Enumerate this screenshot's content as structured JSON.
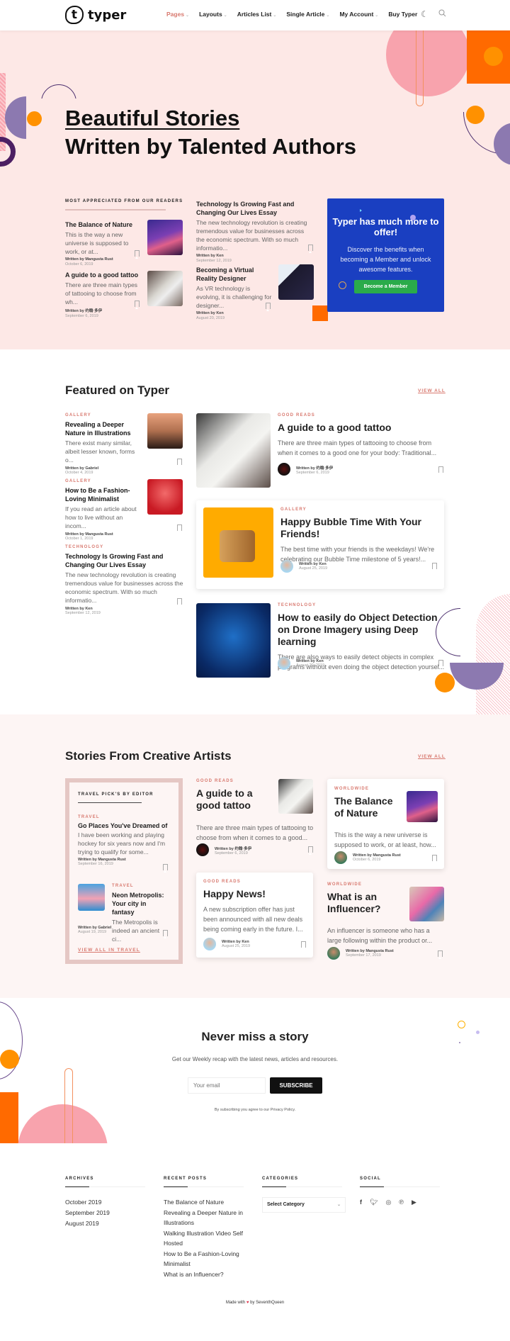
{
  "header": {
    "logo_mark": "t",
    "logo_text": "typer",
    "nav": [
      {
        "label": "Pages",
        "active": true,
        "has_dropdown": true
      },
      {
        "label": "Layouts",
        "active": false,
        "has_dropdown": true
      },
      {
        "label": "Articles List",
        "active": false,
        "has_dropdown": true
      },
      {
        "label": "Single Article",
        "active": false,
        "has_dropdown": true
      },
      {
        "label": "My Account",
        "active": false,
        "has_dropdown": true
      },
      {
        "label": "Buy Typer",
        "active": false,
        "has_dropdown": false
      }
    ],
    "icons": [
      "dark-mode-icon",
      "search-icon"
    ]
  },
  "hero": {
    "title_line1": "Beautiful Stories",
    "title_line2": "Written by Talented Authors",
    "section_label": "MOST APPRECIATED FROM OUR READERS",
    "posts": [
      {
        "title": "The Balance of Nature",
        "excerpt": "This is the way a new universe is supposed to work, or at...",
        "author": "Written by Mangusta Rust",
        "date": "October 6, 2019"
      },
      {
        "title": "A guide to a good tattoo",
        "excerpt": "There are three main types of tattooing to choose from wh...",
        "author": "Written by 约翰·多伊",
        "date": "September 6, 2019"
      },
      {
        "title": "Technology Is Growing Fast and Changing Our Lives Essay",
        "excerpt": "The new technology revolution is creating tremendous value for businesses across the economic spectrum. With so much informatio...",
        "author": "Written by Ken",
        "date": "September 12, 2019"
      },
      {
        "title": "Becoming a Virtual Reality Designer",
        "excerpt": "As VR technology is evolving, it is challenging for designer...",
        "author": "Written by Ken",
        "date": "August 20, 2019"
      }
    ],
    "promo": {
      "title": "Typer has much more to offer!",
      "text": "Discover the benefits when becoming a Member and unlock awesome features.",
      "button": "Become a Member"
    }
  },
  "featured": {
    "title": "Featured on Typer",
    "view_all": "VIEW ALL",
    "side": [
      {
        "category": "GALLERY",
        "title": "Revealing a Deeper Nature in Illustrations",
        "excerpt": "There exist many similar, albeit lesser known, forms o...",
        "author": "Written by Gabriel",
        "date": "October 4, 2019"
      },
      {
        "category": "GALLERY",
        "title": "How to Be a Fashion-Loving Minimalist",
        "excerpt": "If you read an article about how to live without an incom...",
        "author": "Written by Mangusta Rust",
        "date": "October 1, 2019"
      },
      {
        "category": "TECHNOLOGY",
        "title": "Technology Is Growing Fast and Changing Our Lives Essay",
        "excerpt": "The new technology revolution is creating tremendous value for businesses across the economic spectrum. With so much informatio...",
        "author": "Written by Ken",
        "date": "September 12, 2019"
      }
    ],
    "main": [
      {
        "category": "GOOD READS",
        "title": "A guide to a good tattoo",
        "excerpt": "There are three main types of tattooing to choose from when it comes to a good one for your body: Traditional...",
        "author": "Written by 约翰·多伊",
        "date": "September 6, 2019"
      },
      {
        "category": "GALLERY",
        "title": "Happy Bubble Time With Your Friends!",
        "excerpt": "The best time with your friends is the weekdays! We're celebrating our Bubble Time milestone of 5 years!...",
        "author": "Written by Ken",
        "date": "August 25, 2019"
      },
      {
        "category": "TECHNOLOGY",
        "title": "How to easily do Object Detection on Drone Imagery using Deep learning",
        "excerpt": "There are also ways to easily detect objects in complex programs without even doing the object detection yoursel...",
        "author": "Written by Ken",
        "date": "August 20, 2019"
      }
    ]
  },
  "stories": {
    "title": "Stories From Creative Artists",
    "view_all": "VIEW ALL",
    "editor": {
      "label": "TRAVEL PICK'S BY EDITOR",
      "posts": [
        {
          "category": "TRAVEL",
          "title": "Go Places You've Dreamed of",
          "excerpt": "I have been working and playing hockey for six years now and I'm trying to qualify for some...",
          "author": "Written by Mangusta Rust",
          "date": "September 16, 2019"
        },
        {
          "category": "TRAVEL",
          "title": "Neon Metropolis: Your city in fantasy",
          "excerpt": "The Metropolis is indeed an ancient ci...",
          "author": "Written by Gabriel",
          "date": "August 19, 2019"
        }
      ],
      "view_all": "VIEW ALL IN TRAVEL"
    },
    "cards": [
      {
        "category": "GOOD READS",
        "title": "A guide to a good tattoo",
        "excerpt": "There are three main types of tattooing to choose from when it comes to a good...",
        "author": "Written by 约翰·多伊",
        "date": "September 6, 2019"
      },
      {
        "category": "GOOD READS",
        "title": "Happy News!",
        "excerpt": "A new subscription offer  has just been announced with all new deals being coming early in the future. I...",
        "author": "Written by Ken",
        "date": "August 25, 2019"
      },
      {
        "category": "WORLDWIDE",
        "title": "The Balance of Nature",
        "excerpt": "This is the way a new universe is supposed to work, or at least, how...",
        "author": "Written by Mangusta Rust",
        "date": "October 6, 2019"
      },
      {
        "category": "WORLDWIDE",
        "title": "What is an Influencer?",
        "excerpt": "An influencer is someone who has a large following within the product or...",
        "author": "Written by Mangusta Rust",
        "date": "September 17, 2019"
      }
    ]
  },
  "newsletter": {
    "title": "Never miss a story",
    "subtitle": "Get our Weekly recap with the latest news, articles and resources.",
    "email_placeholder": "Your email",
    "button": "SUBSCRIBE",
    "policy": "By subscribing you agree to our Privacy Policy."
  },
  "footer": {
    "archives": {
      "title": "ARCHIVES",
      "items": [
        "October 2019",
        "September 2019",
        "August 2019"
      ]
    },
    "recent": {
      "title": "RECENT POSTS",
      "items": [
        "The Balance of Nature",
        "Revealing a Deeper Nature in Illustrations",
        "Walking Illustration Video Self Hosted",
        "How to Be a Fashion-Loving Minimalist",
        "What is an Influencer?"
      ]
    },
    "categories": {
      "title": "CATEGORIES",
      "select": "Select Category"
    },
    "social": {
      "title": "SOCIAL",
      "icons": [
        "facebook-icon",
        "twitter-icon",
        "instagram-icon",
        "pinterest-icon",
        "youtube-icon"
      ]
    },
    "made_prefix": "Made with",
    "made_suffix": "by SeventhQueen"
  },
  "colors": {
    "accent": "#d8796f",
    "hero_bg": "#fde8e6",
    "promo_bg": "#1a3fc1",
    "promo_button": "#2aab4a",
    "orange": "#ff6a00",
    "purple": "#8c79b0",
    "pink": "#f8a3ad"
  }
}
